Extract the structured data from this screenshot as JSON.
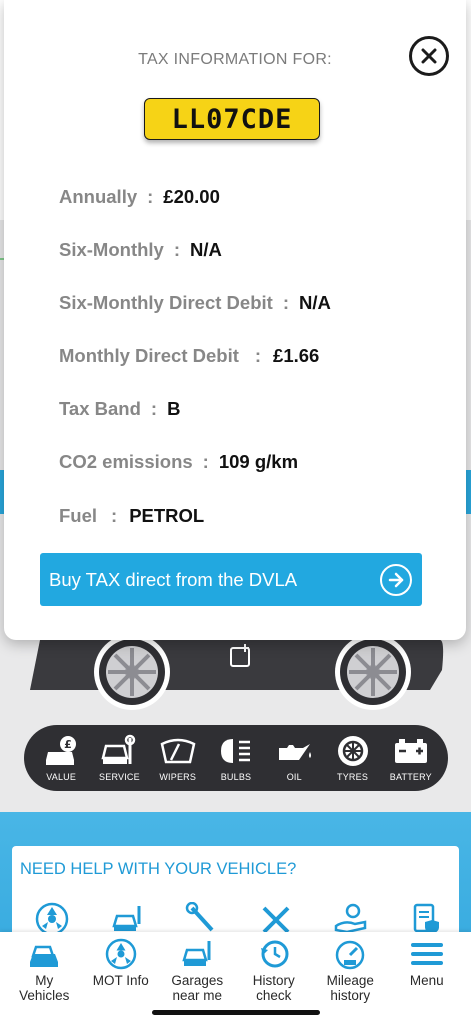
{
  "modal": {
    "title": "TAX INFORMATION FOR:",
    "plate": "LL07CDE",
    "rows": [
      {
        "label": "Annually",
        "value": "£20.00"
      },
      {
        "label": "Six-Monthly",
        "value": "N/A"
      },
      {
        "label": "Six-Monthly Direct Debit",
        "value": "N/A"
      },
      {
        "label": "Monthly Direct Debit",
        "value": "£1.66"
      },
      {
        "label": "Tax Band",
        "value": "B"
      },
      {
        "label": "CO2 emissions",
        "value": "109 g/km"
      },
      {
        "label": "Fuel",
        "value": "PETROL"
      }
    ],
    "separator": ":",
    "buy_button": "Buy TAX direct from the DVLA"
  },
  "services": [
    {
      "label": "VALUE",
      "icon": "value-icon"
    },
    {
      "label": "SERVICE",
      "icon": "service-icon"
    },
    {
      "label": "WIPERS",
      "icon": "wipers-icon"
    },
    {
      "label": "BULBS",
      "icon": "bulbs-icon"
    },
    {
      "label": "OIL",
      "icon": "oil-icon"
    },
    {
      "label": "TYRES",
      "icon": "tyres-icon"
    },
    {
      "label": "BATTERY",
      "icon": "battery-icon"
    }
  ],
  "help": {
    "title": "NEED HELP WITH YOUR VEHICLE?"
  },
  "tabbar": [
    {
      "label": "My\nVehicles",
      "icon": "cars-icon"
    },
    {
      "label": "MOT Info",
      "icon": "mot-icon"
    },
    {
      "label": "Garages\nnear me",
      "icon": "garage-icon"
    },
    {
      "label": "History\ncheck",
      "icon": "history-icon"
    },
    {
      "label": "Mileage\nhistory",
      "icon": "mileage-icon"
    },
    {
      "label": "Menu",
      "icon": "menu-icon"
    }
  ],
  "colors": {
    "accent": "#22a8e0",
    "plate": "#f6d316",
    "dark_bar": "#2f2f33"
  }
}
